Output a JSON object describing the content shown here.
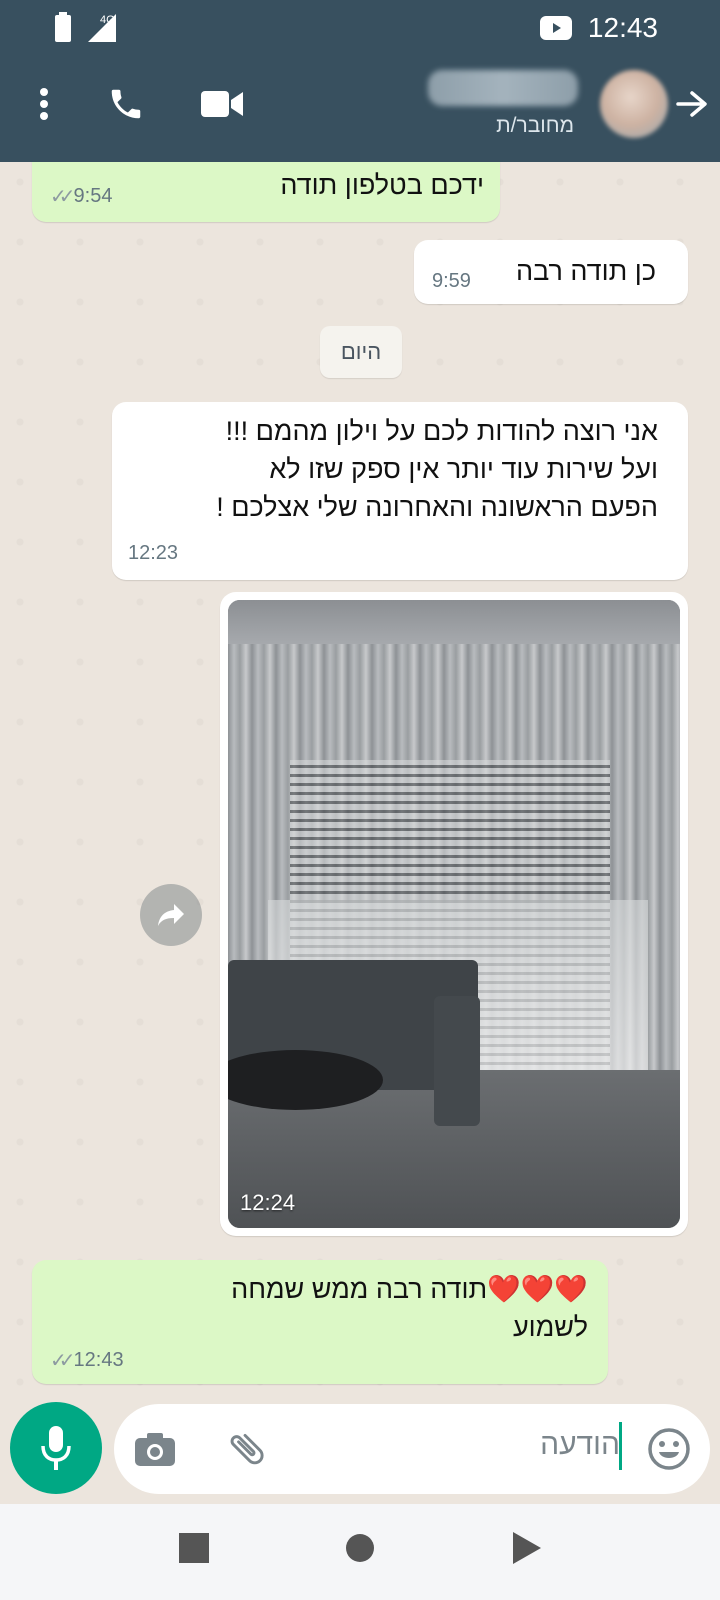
{
  "status_bar": {
    "time": "12:43",
    "network": "4G",
    "icons": [
      "battery-icon",
      "signal-icon",
      "youtube-icon"
    ]
  },
  "header": {
    "contact_status": "מחובר/ת",
    "icons": [
      "menu-dots-icon",
      "phone-icon",
      "video-call-icon",
      "back-arrow-icon"
    ]
  },
  "messages": [
    {
      "direction": "out",
      "text": "ידכם בטלפון תודה",
      "time": "9:54",
      "read": true
    },
    {
      "direction": "in",
      "text": "כן תודה רבה",
      "time": "9:59"
    },
    {
      "direction": "date",
      "text": "היום"
    },
    {
      "direction": "in",
      "lines": [
        "אני רוצה להודות לכם על וילון מהמם !!!",
        "ועל שירות עוד יותר אין ספק שזו לא",
        "הפעם הראשונה והאחרונה שלי אצלכם !"
      ],
      "time": "12:23"
    },
    {
      "direction": "in",
      "type": "image",
      "time": "12:24"
    },
    {
      "direction": "out",
      "lines": [
        "❤️❤️❤️תודה רבה ממש שמחה",
        "לשמוע"
      ],
      "time": "12:43",
      "read": true
    }
  ],
  "input": {
    "placeholder": "הודעה",
    "icons": [
      "emoji-icon",
      "attach-icon",
      "camera-icon",
      "mic-icon"
    ]
  },
  "colors": {
    "header": "#38505f",
    "chat_bg": "#ece5dd",
    "outgoing": "#dcf8c6",
    "incoming": "#ffffff",
    "accent": "#00a884"
  }
}
